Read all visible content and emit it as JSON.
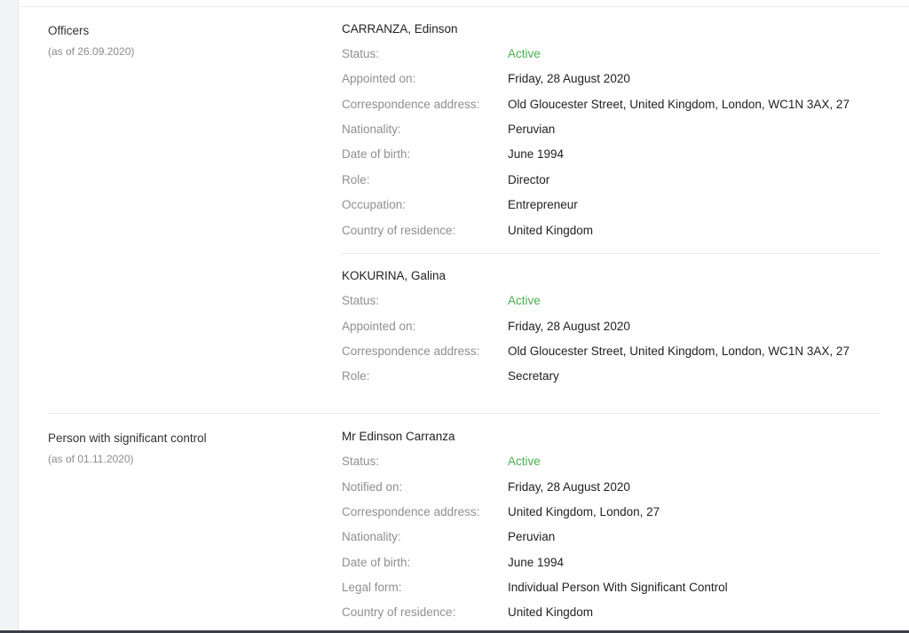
{
  "officers": {
    "title": "Officers",
    "as_of": "(as of 26.09.2020)",
    "persons": [
      {
        "name": "CARRANZA, Edinson",
        "rows": [
          {
            "label": "Status:",
            "value": "Active",
            "status": true
          },
          {
            "label": "Appointed on:",
            "value": "Friday, 28 August 2020"
          },
          {
            "label": "Correspondence address:",
            "value": "Old Gloucester Street, United Kingdom, London, WC1N 3AX, 27"
          },
          {
            "label": "Nationality:",
            "value": "Peruvian"
          },
          {
            "label": "Date of birth:",
            "value": "June 1994"
          },
          {
            "label": "Role:",
            "value": "Director"
          },
          {
            "label": "Occupation:",
            "value": "Entrepreneur"
          },
          {
            "label": "Country of residence:",
            "value": "United Kingdom"
          }
        ]
      },
      {
        "name": "KOKURINA, Galina",
        "rows": [
          {
            "label": "Status:",
            "value": "Active",
            "status": true
          },
          {
            "label": "Appointed on:",
            "value": "Friday, 28 August 2020"
          },
          {
            "label": "Correspondence address:",
            "value": "Old Gloucester Street, United Kingdom, London, WC1N 3AX, 27"
          },
          {
            "label": "Role:",
            "value": "Secretary"
          }
        ]
      }
    ]
  },
  "psc": {
    "title": "Person with significant control",
    "as_of": "(as of 01.11.2020)",
    "persons": [
      {
        "name": "Mr Edinson Carranza",
        "rows": [
          {
            "label": "Status:",
            "value": "Active",
            "status": true
          },
          {
            "label": "Notified on:",
            "value": "Friday, 28 August 2020"
          },
          {
            "label": "Correspondence address:",
            "value": "United Kingdom, London, 27"
          },
          {
            "label": "Nationality:",
            "value": "Peruvian"
          },
          {
            "label": "Date of birth:",
            "value": "June 1994"
          },
          {
            "label": "Legal form:",
            "value": "Individual Person With Significant Control"
          },
          {
            "label": "Country of residence:",
            "value": "United Kingdom"
          }
        ]
      }
    ]
  },
  "colors": {
    "status_active": "#4caf50",
    "label": "#8f8f8f",
    "text": "#222222"
  }
}
